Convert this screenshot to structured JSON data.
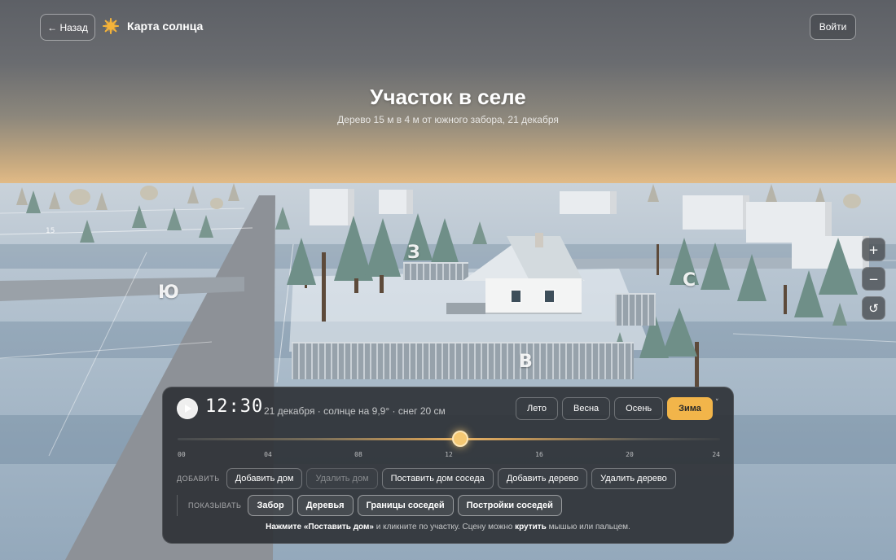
{
  "header": {
    "back_label": "← Назад",
    "app_title": "Карта солнца",
    "login_label": "Войти"
  },
  "scene": {
    "title": "Участок в селе",
    "subtitle": "Дерево 15 м в 4 м от южного забора, 21 декабря",
    "compass": {
      "west": "З",
      "south": "Ю",
      "east": "В",
      "north": "С"
    },
    "plot_number": "15"
  },
  "zoom": {
    "in": "+",
    "out": "−",
    "reset": "↺"
  },
  "panel": {
    "time": "12:30",
    "info": "21 декабря · солнце на 9,9° · снег 20 см",
    "seasons": [
      "Лето",
      "Весна",
      "Осень",
      "Зима"
    ],
    "active_season": "Зима",
    "collapse": "˅",
    "time_fraction": 0.521,
    "ticks": [
      "00",
      "04",
      "08",
      "12",
      "16",
      "20",
      "24"
    ],
    "add_label": "ДОБАВИТЬ",
    "add_buttons": [
      "Добавить дом",
      "Удалить дом",
      "Поставить дом соседа",
      "Добавить дерево",
      "Удалить дерево"
    ],
    "show_label": "ПОКАЗЫВАТЬ",
    "show_buttons": [
      "Забор",
      "Деревья",
      "Границы соседей",
      "Постройки соседей"
    ],
    "hint": {
      "p1": "Нажмите «Поставить дом»",
      "p2": " и кликните по участку. Сцену можно ",
      "p3": "крутить",
      "p4": " мышью или пальцем."
    }
  },
  "colors": {
    "accent": "#f2b54a",
    "panel": "#2c3034"
  }
}
